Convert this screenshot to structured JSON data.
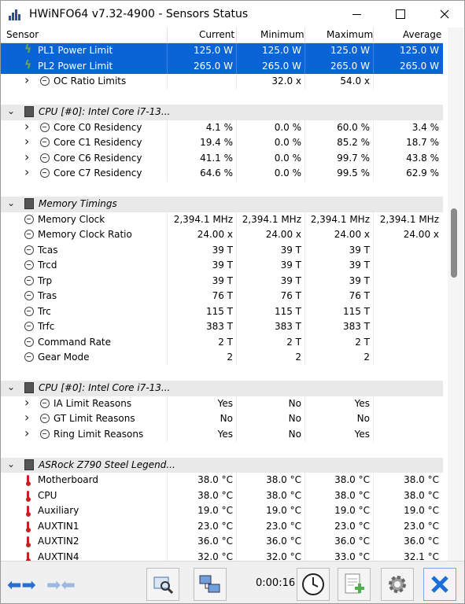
{
  "window": {
    "title": "HWiNFO64 v7.32-4900 - Sensors Status"
  },
  "columns": [
    "Sensor",
    "Current",
    "Minimum",
    "Maximum",
    "Average"
  ],
  "rows": [
    {
      "type": "item",
      "indent": 1,
      "icon": "bolt-icon",
      "label": "PL1 Power Limit",
      "cur": "125.0 W",
      "min": "125.0 W",
      "max": "125.0 W",
      "avg": "125.0 W",
      "selected": true
    },
    {
      "type": "item",
      "indent": 1,
      "icon": "bolt-icon",
      "label": "PL2 Power Limit",
      "cur": "265.0 W",
      "min": "265.0 W",
      "max": "265.0 W",
      "avg": "265.0 W",
      "selected": true
    },
    {
      "type": "item",
      "indent": 2,
      "expand": true,
      "icon": "clock-icon",
      "label": "OC Ratio Limits",
      "cur": "",
      "min": "32.0 x",
      "max": "54.0 x",
      "avg": ""
    },
    {
      "type": "spacer"
    },
    {
      "type": "group",
      "label": "CPU [#0]: Intel Core i7-13..."
    },
    {
      "type": "item",
      "indent": 2,
      "expand": true,
      "icon": "clock-icon",
      "label": "Core C0 Residency",
      "cur": "4.1 %",
      "min": "0.0 %",
      "max": "60.0 %",
      "avg": "3.4 %"
    },
    {
      "type": "item",
      "indent": 2,
      "expand": true,
      "icon": "clock-icon",
      "label": "Core C1 Residency",
      "cur": "19.4 %",
      "min": "0.0 %",
      "max": "85.2 %",
      "avg": "18.7 %"
    },
    {
      "type": "item",
      "indent": 2,
      "expand": true,
      "icon": "clock-icon",
      "label": "Core C6 Residency",
      "cur": "41.1 %",
      "min": "0.0 %",
      "max": "99.7 %",
      "avg": "43.8 %"
    },
    {
      "type": "item",
      "indent": 2,
      "expand": true,
      "icon": "clock-icon",
      "label": "Core C7 Residency",
      "cur": "64.6 %",
      "min": "0.0 %",
      "max": "99.5 %",
      "avg": "62.9 %"
    },
    {
      "type": "spacer"
    },
    {
      "type": "group",
      "label": "Memory Timings"
    },
    {
      "type": "item",
      "indent": 1,
      "icon": "clock-icon",
      "label": "Memory Clock",
      "cur": "2,394.1 MHz",
      "min": "2,394.1 MHz",
      "max": "2,394.1 MHz",
      "avg": "2,394.1 MHz"
    },
    {
      "type": "item",
      "indent": 1,
      "icon": "clock-icon",
      "label": "Memory Clock Ratio",
      "cur": "24.00 x",
      "min": "24.00 x",
      "max": "24.00 x",
      "avg": "24.00 x"
    },
    {
      "type": "item",
      "indent": 1,
      "icon": "clock-icon",
      "label": "Tcas",
      "cur": "39 T",
      "min": "39 T",
      "max": "39 T",
      "avg": ""
    },
    {
      "type": "item",
      "indent": 1,
      "icon": "clock-icon",
      "label": "Trcd",
      "cur": "39 T",
      "min": "39 T",
      "max": "39 T",
      "avg": ""
    },
    {
      "type": "item",
      "indent": 1,
      "icon": "clock-icon",
      "label": "Trp",
      "cur": "39 T",
      "min": "39 T",
      "max": "39 T",
      "avg": ""
    },
    {
      "type": "item",
      "indent": 1,
      "icon": "clock-icon",
      "label": "Tras",
      "cur": "76 T",
      "min": "76 T",
      "max": "76 T",
      "avg": ""
    },
    {
      "type": "item",
      "indent": 1,
      "icon": "clock-icon",
      "label": "Trc",
      "cur": "115 T",
      "min": "115 T",
      "max": "115 T",
      "avg": ""
    },
    {
      "type": "item",
      "indent": 1,
      "icon": "clock-icon",
      "label": "Trfc",
      "cur": "383 T",
      "min": "383 T",
      "max": "383 T",
      "avg": ""
    },
    {
      "type": "item",
      "indent": 1,
      "icon": "clock-icon",
      "label": "Command Rate",
      "cur": "2 T",
      "min": "2 T",
      "max": "2 T",
      "avg": ""
    },
    {
      "type": "item",
      "indent": 1,
      "icon": "clock-icon",
      "label": "Gear Mode",
      "cur": "2",
      "min": "2",
      "max": "2",
      "avg": ""
    },
    {
      "type": "spacer"
    },
    {
      "type": "group",
      "label": "CPU [#0]: Intel Core i7-13..."
    },
    {
      "type": "item",
      "indent": 2,
      "expand": true,
      "icon": "clock-icon",
      "label": "IA Limit Reasons",
      "cur": "Yes",
      "min": "No",
      "max": "Yes",
      "avg": ""
    },
    {
      "type": "item",
      "indent": 2,
      "expand": true,
      "icon": "clock-icon",
      "label": "GT Limit Reasons",
      "cur": "No",
      "min": "No",
      "max": "No",
      "avg": ""
    },
    {
      "type": "item",
      "indent": 2,
      "expand": true,
      "icon": "clock-icon",
      "label": "Ring Limit Reasons",
      "cur": "Yes",
      "min": "No",
      "max": "Yes",
      "avg": ""
    },
    {
      "type": "spacer"
    },
    {
      "type": "group",
      "label": "ASRock Z790 Steel Legend..."
    },
    {
      "type": "item",
      "indent": 1,
      "icon": "thermometer-icon",
      "label": "Motherboard",
      "cur": "38.0 °C",
      "min": "38.0 °C",
      "max": "38.0 °C",
      "avg": "38.0 °C"
    },
    {
      "type": "item",
      "indent": 1,
      "icon": "thermometer-icon",
      "label": "CPU",
      "cur": "38.0 °C",
      "min": "38.0 °C",
      "max": "38.0 °C",
      "avg": "38.0 °C"
    },
    {
      "type": "item",
      "indent": 1,
      "icon": "thermometer-icon",
      "label": "Auxiliary",
      "cur": "19.0 °C",
      "min": "19.0 °C",
      "max": "19.0 °C",
      "avg": "19.0 °C"
    },
    {
      "type": "item",
      "indent": 1,
      "icon": "thermometer-icon",
      "label": "AUXTIN1",
      "cur": "23.0 °C",
      "min": "23.0 °C",
      "max": "23.0 °C",
      "avg": "23.0 °C"
    },
    {
      "type": "item",
      "indent": 1,
      "icon": "thermometer-icon",
      "label": "AUXTIN2",
      "cur": "36.0 °C",
      "min": "36.0 °C",
      "max": "36.0 °C",
      "avg": "36.0 °C"
    },
    {
      "type": "item",
      "indent": 1,
      "icon": "thermometer-icon",
      "label": "AUXTIN4",
      "cur": "32.0 °C",
      "min": "32.0 °C",
      "max": "33.0 °C",
      "avg": "32.1 °C"
    }
  ],
  "toolbar": {
    "timer": "0:00:16",
    "icons": [
      "nav-left-right-icon",
      "collapse-arrows-icon",
      "sensor-search-icon",
      "network-icon",
      "clock-icon",
      "report-add-icon",
      "settings-gear-icon",
      "close-x-icon"
    ]
  },
  "colors": {
    "selection": "#0a64d6",
    "group_bg": "#e9e9e9",
    "close_blue": "#1c6fd8"
  }
}
